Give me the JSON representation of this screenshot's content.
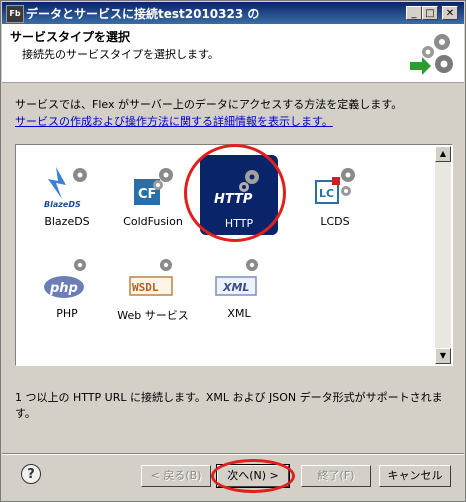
{
  "window": {
    "title": "データとサービスに接続test2010323 の",
    "app_icon": "Fb"
  },
  "header": {
    "title": "サービスタイプを選択",
    "subtitle": "接続先のサービスタイプを選択します。"
  },
  "description": "サービスでは、Flex がサーバー上のデータにアクセスする方法を定義します。",
  "link": "サービスの作成および操作方法に関する詳細情報を表示します。",
  "services": [
    {
      "label": "BlazeDS",
      "logo": "BlazeDS",
      "icon": "blazeds-icon"
    },
    {
      "label": "ColdFusion",
      "logo": "CF",
      "icon": "coldfusion-icon"
    },
    {
      "label": "HTTP",
      "logo": "HTTP",
      "icon": "http-icon",
      "selected": true
    },
    {
      "label": "LCDS",
      "logo": "LC",
      "icon": "lcds-icon"
    },
    {
      "label": "PHP",
      "logo": "php",
      "icon": "php-icon"
    },
    {
      "label": "Web サービス",
      "logo": "WSDL",
      "icon": "wsdl-icon"
    },
    {
      "label": "XML",
      "logo": "XML",
      "icon": "xml-icon"
    }
  ],
  "info": "1 つ以上の HTTP URL に接続します。XML および JSON データ形式がサポートされます。",
  "buttons": {
    "back": "< 戻る(B)",
    "next": "次へ(N) >",
    "finish": "終了(F)",
    "cancel": "キャンセル"
  },
  "help": "?",
  "colors": {
    "highlight": "#0a246a",
    "annotation": "#e0201a",
    "link": "#0000cc"
  }
}
